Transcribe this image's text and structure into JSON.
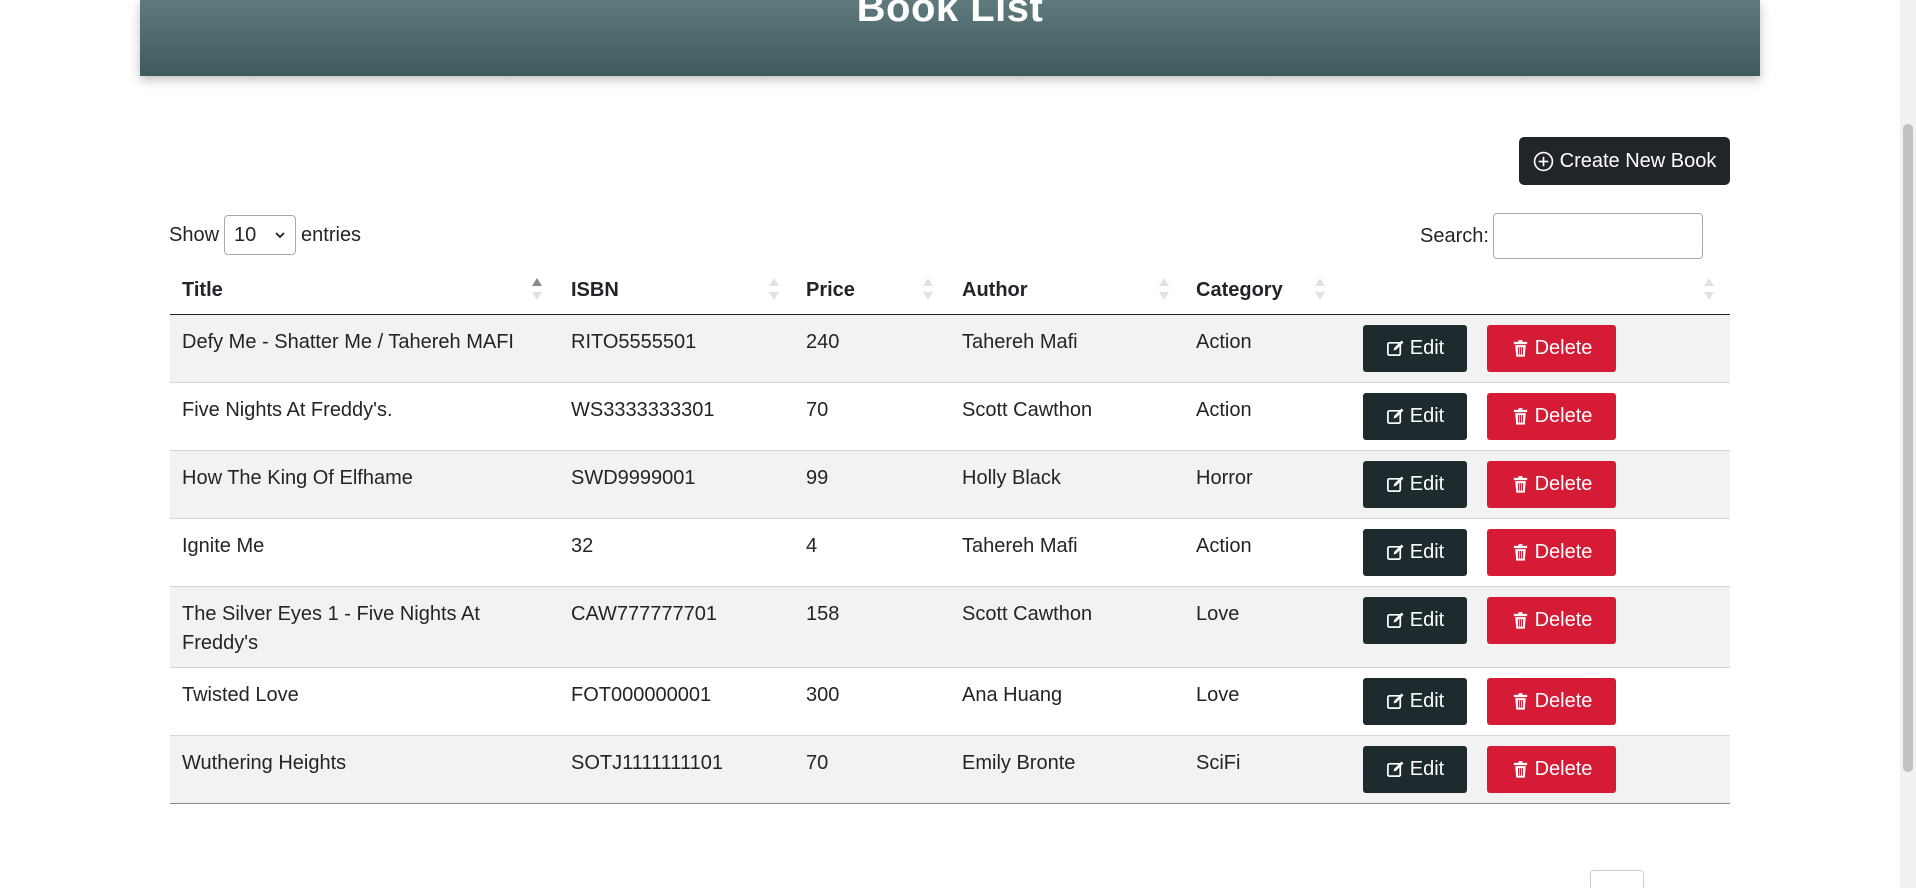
{
  "header": {
    "title": "Book List"
  },
  "toolbar": {
    "create_label": "Create New Book"
  },
  "length_control": {
    "show_label": "Show",
    "selected": "10",
    "entries_label": "entries"
  },
  "search": {
    "label": "Search:",
    "value": ""
  },
  "table": {
    "columns": [
      "Title",
      "ISBN",
      "Price",
      "Author",
      "Category",
      ""
    ],
    "sorted_column": "Title",
    "sort_direction": "ascending",
    "rows": [
      {
        "title": "Defy Me - Shatter Me / Tahereh MAFI",
        "isbn": "RITO5555501",
        "price": "240",
        "author": "Tahereh Mafi",
        "category": "Action"
      },
      {
        "title": "Five Nights At Freddy's.",
        "isbn": "WS3333333301",
        "price": "70",
        "author": "Scott Cawthon",
        "category": "Action"
      },
      {
        "title": "How The King Of Elfhame",
        "isbn": "SWD9999001",
        "price": "99",
        "author": "Holly Black",
        "category": "Horror"
      },
      {
        "title": "Ignite Me",
        "isbn": "32",
        "price": "4",
        "author": "Tahereh Mafi",
        "category": "Action"
      },
      {
        "title": "The Silver Eyes 1 - Five Nights At Freddy's",
        "isbn": "CAW777777701",
        "price": "158",
        "author": "Scott Cawthon",
        "category": "Love"
      },
      {
        "title": "Twisted Love",
        "isbn": "FOT000000001",
        "price": "300",
        "author": "Ana Huang",
        "category": "Love"
      },
      {
        "title": "Wuthering Heights",
        "isbn": "SOTJ1111111101",
        "price": "70",
        "author": "Emily Bronte",
        "category": "SciFi"
      }
    ],
    "edit_label": "Edit",
    "delete_label": "Delete"
  },
  "icons": {
    "create": "plus-circle-icon",
    "edit": "pencil-square-icon",
    "delete": "trash-icon",
    "sort": "sort-icon",
    "select_arrow": "chevron-down-icon"
  },
  "colors": {
    "header_top": "#5f7a7d",
    "header_bottom": "#3f5a5e",
    "dark_button": "#212529",
    "edit_button": "#1e2b2e",
    "delete_button": "#d61b36",
    "stripe": "#f2f2f2"
  }
}
